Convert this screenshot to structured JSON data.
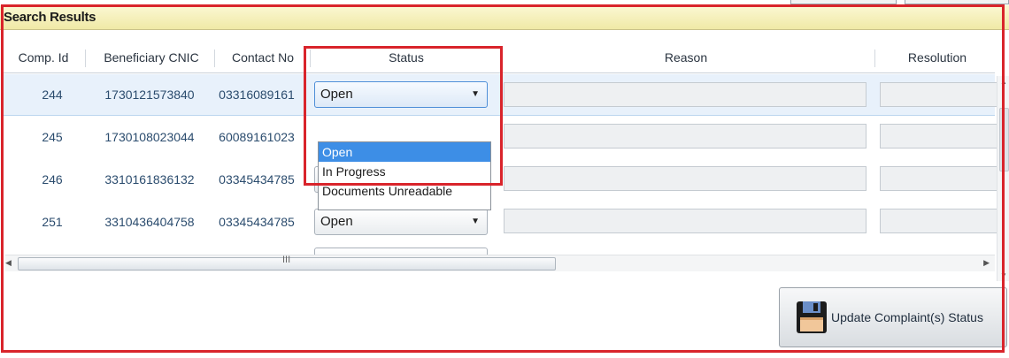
{
  "panel": {
    "title": "Search Results"
  },
  "columns": [
    "Comp. Id",
    "Beneficiary CNIC",
    "Contact No",
    "Status",
    "Reason",
    "Resolution"
  ],
  "rows": [
    {
      "comp_id": "244",
      "cnic": "1730121573840",
      "contact": "03316089161",
      "status": "Open",
      "selected": true
    },
    {
      "comp_id": "245",
      "cnic": "1730108023044",
      "contact": "60089161023",
      "status": "",
      "selected": false
    },
    {
      "comp_id": "246",
      "cnic": "3310161836132",
      "contact": "03345434785",
      "status": "",
      "selected": false
    },
    {
      "comp_id": "251",
      "cnic": "3310436404758",
      "contact": "03345434785",
      "status": "Open",
      "selected": false
    }
  ],
  "status_dropdown": {
    "options": [
      "Open",
      "In Progress",
      "Documents Unreadable"
    ],
    "selected_index": 0
  },
  "scrollbar": {
    "grip": "III"
  },
  "update_button": {
    "label": "Update Complaint(s) Status",
    "icon": "floppy-disk-icon"
  },
  "colors": {
    "highlight": "#d9242b",
    "title_bar": "#f0e9a6",
    "selection": "#3d8ee6"
  }
}
